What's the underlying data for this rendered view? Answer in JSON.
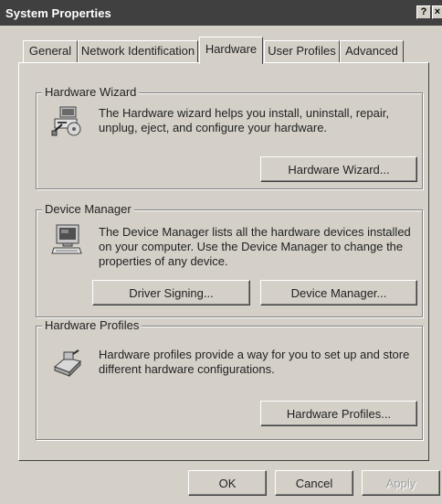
{
  "window": {
    "title": "System Properties",
    "help_glyph": "?",
    "close_glyph": "×"
  },
  "tabs": [
    {
      "label": "General",
      "active": false
    },
    {
      "label": "Network Identification",
      "active": false
    },
    {
      "label": "Hardware",
      "active": true
    },
    {
      "label": "User Profiles",
      "active": false
    },
    {
      "label": "Advanced",
      "active": false
    }
  ],
  "groups": {
    "hardware_wizard": {
      "legend": "Hardware Wizard",
      "icon": "hardware-wizard-icon",
      "description": "The Hardware wizard helps you install, uninstall, repair, unplug, eject, and configure your hardware.",
      "button": "Hardware Wizard..."
    },
    "device_manager": {
      "legend": "Device Manager",
      "icon": "computer-icon",
      "description": "The Device Manager lists all the hardware devices installed on your computer. Use the Device Manager to change the properties of any device.",
      "buttons": {
        "driver_signing": "Driver Signing...",
        "device_manager": "Device Manager..."
      }
    },
    "hardware_profiles": {
      "legend": "Hardware Profiles",
      "icon": "hardware-profiles-icon",
      "description": "Hardware profiles provide a way for you to set up and store different hardware configurations.",
      "button": "Hardware Profiles..."
    }
  },
  "footer": {
    "ok": "OK",
    "cancel": "Cancel",
    "apply": "Apply",
    "apply_enabled": false
  }
}
